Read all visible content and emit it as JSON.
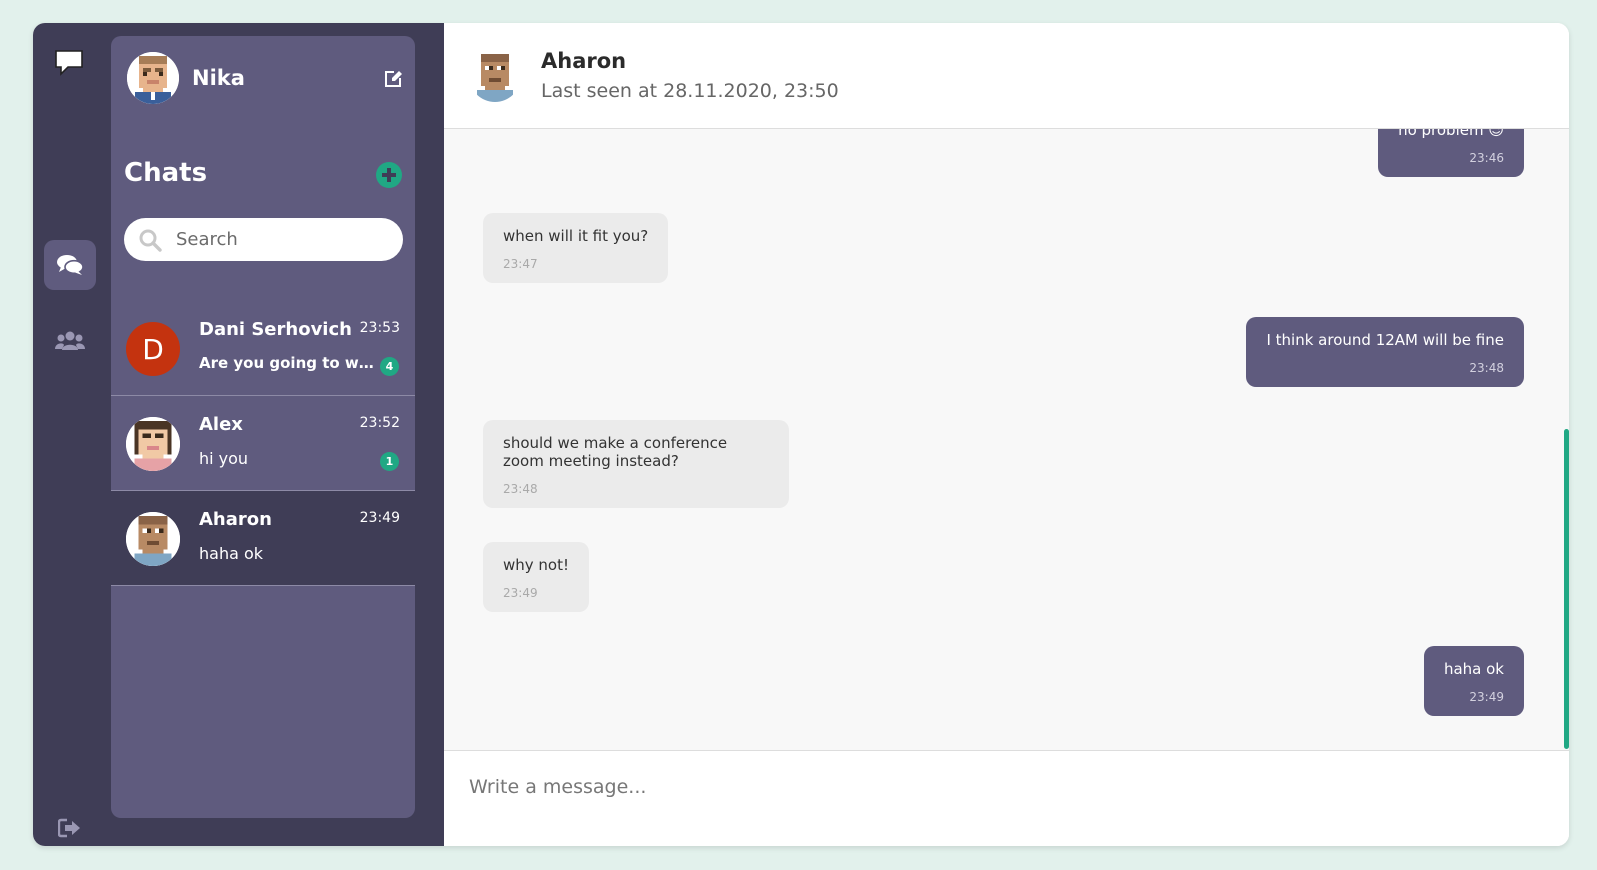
{
  "colors": {
    "rail": "#3f3d56",
    "panel": "#5f5b7e",
    "accent": "#20a884",
    "background": "#e2f1ec"
  },
  "rail": {
    "logo_icon": "speech-bubble-icon",
    "nav": [
      {
        "icon": "chats-icon",
        "active": true
      },
      {
        "icon": "contacts-icon",
        "active": false
      }
    ],
    "logout_icon": "logout-icon"
  },
  "profile": {
    "name": "Nika",
    "avatar": "pixel-avatar-nika"
  },
  "sidebar": {
    "title": "Chats",
    "search": {
      "placeholder": "Search",
      "value": ""
    },
    "chats": [
      {
        "name": "Dani Serhovich",
        "time": "23:53",
        "preview": "Are you going to watch",
        "unread": "4",
        "avatar_letter": "D",
        "selected": false
      },
      {
        "name": "Alex",
        "time": "23:52",
        "preview": "hi you",
        "unread": "1",
        "selected": false
      },
      {
        "name": "Aharon",
        "time": "23:49",
        "preview": "haha ok",
        "unread": "",
        "selected": true
      }
    ]
  },
  "conversation": {
    "name": "Aharon",
    "status": "Last seen at 28.11.2020, 23:50",
    "messages": [
      {
        "dir": "out",
        "text": "no problem 😉",
        "time": "23:46"
      },
      {
        "dir": "in",
        "text": "when will it fit you?",
        "time": "23:47"
      },
      {
        "dir": "out",
        "text": "I think around 12AM will be fine",
        "time": "23:48"
      },
      {
        "dir": "in",
        "text": "should we make a conference zoom meeting instead?",
        "time": "23:48"
      },
      {
        "dir": "in",
        "text": "why not!",
        "time": "23:49"
      },
      {
        "dir": "out",
        "text": "haha ok",
        "time": "23:49"
      }
    ],
    "composer_placeholder": "Write a message..."
  }
}
